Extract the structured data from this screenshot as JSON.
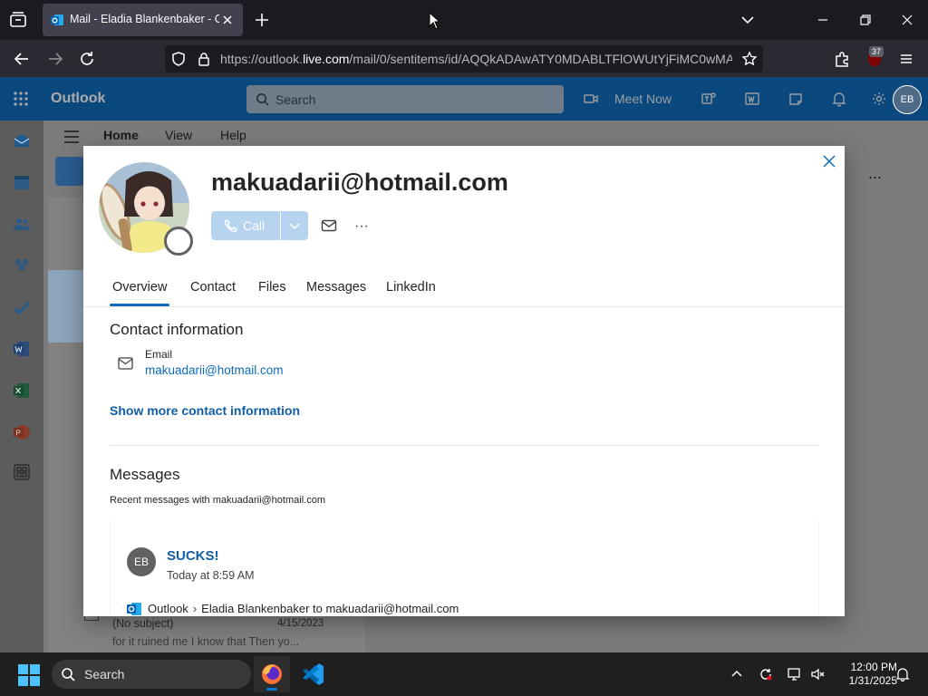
{
  "browser": {
    "tab_title": "Mail - Eladia Blankenbaker - Outlook",
    "url_prefix": "https://outlook.",
    "url_domain": "live.com",
    "url_rest": "/mail/0/sentitems/id/AQQkADAwATY0MDABLTFlOWUtYjFiMC0wMA",
    "extensions_badge": "37"
  },
  "outlook": {
    "brand": "Outlook",
    "search_placeholder": "Search",
    "meet_now": "Meet Now",
    "user_initials": "EB",
    "ribbon_tabs": [
      "Home",
      "View",
      "Help"
    ],
    "ribbon_more": "...",
    "list_behind": {
      "subject": "(No subject)",
      "date": "4/15/2023",
      "preview": "for it ruined me I know that Then yo..."
    }
  },
  "contact_card": {
    "name": "makuadarii@hotmail.com",
    "call_label": "Call",
    "more_label": "···",
    "tabs": [
      "Overview",
      "Contact",
      "Files",
      "Messages",
      "LinkedIn"
    ],
    "active_tab": "Overview",
    "contact_section_title": "Contact information",
    "email_label": "Email",
    "email_value": "makuadarii@hotmail.com",
    "show_more": "Show more contact information",
    "messages_title": "Messages",
    "messages_subtitle": "Recent messages with makuadarii@hotmail.com",
    "message": {
      "avatar_initials": "EB",
      "subject": "SUCKS!",
      "time": "Today at 8:59 AM",
      "app": "Outlook",
      "route": "Eladia Blankenbaker to makuadarii@hotmail.com"
    }
  },
  "taskbar": {
    "search_label": "Search",
    "time": "12:00 PM",
    "date": "1/31/2025"
  },
  "colors": {
    "outlook_blue": "#0f6cbd",
    "link_blue": "#115ea3",
    "call_disabled": "#b6d3f0",
    "browser_tab": "#42414d"
  }
}
